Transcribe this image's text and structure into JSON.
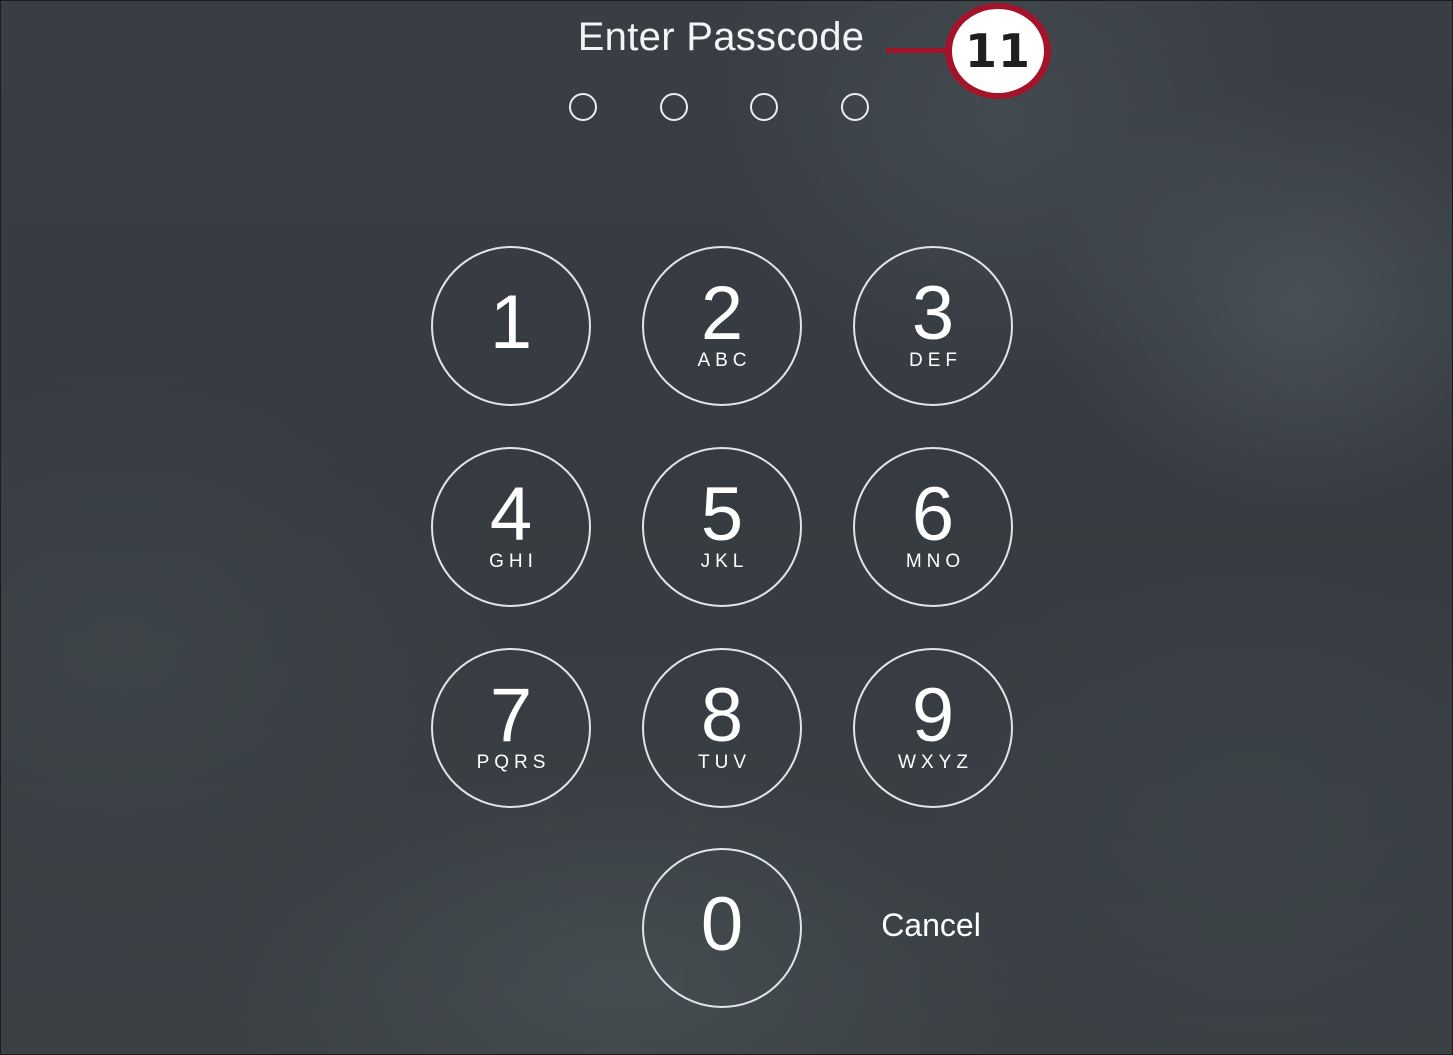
{
  "title": "Enter Passcode",
  "passcode_dots_filled": 0,
  "keypad": {
    "keys": [
      {
        "digit": "1",
        "letters": ""
      },
      {
        "digit": "2",
        "letters": "ABC"
      },
      {
        "digit": "3",
        "letters": "DEF"
      },
      {
        "digit": "4",
        "letters": "GHI"
      },
      {
        "digit": "5",
        "letters": "JKL"
      },
      {
        "digit": "6",
        "letters": "MNO"
      },
      {
        "digit": "7",
        "letters": "PQRS"
      },
      {
        "digit": "8",
        "letters": "TUV"
      },
      {
        "digit": "9",
        "letters": "WXYZ"
      },
      {
        "digit": "0",
        "letters": ""
      }
    ]
  },
  "cancel_label": "Cancel",
  "callout": {
    "number": "11",
    "color": "#a3142b"
  }
}
